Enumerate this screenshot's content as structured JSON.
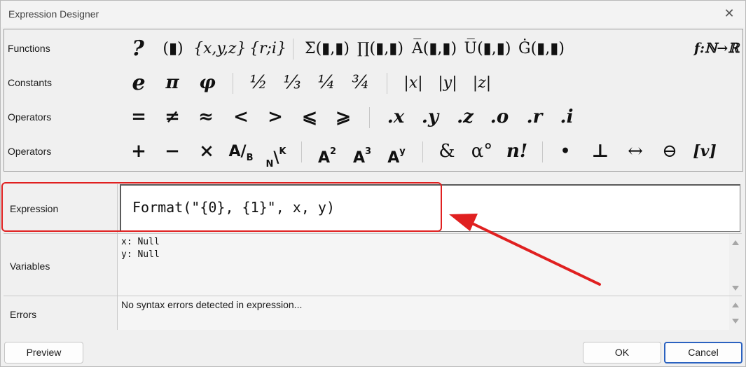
{
  "window": {
    "title": "Expression Designer",
    "close_glyph": "✕"
  },
  "palette": {
    "rows": [
      {
        "label": "Functions"
      },
      {
        "label": "Constants"
      },
      {
        "label": "Operators"
      },
      {
        "label": "Operators"
      }
    ],
    "functions": {
      "conditional": "?",
      "parens": "(▮)",
      "tuple3": "{x,y,z}",
      "tuple2": "{r;i}",
      "sum": "Σ(▮,▮)",
      "product": "∏(▮,▮)",
      "avg": "A̅(▮,▮)",
      "union": "U̅(▮,▮)",
      "g_func": "Ġ(▮,▮)",
      "function_map": "f:ℕ→ℝ"
    },
    "constants": {
      "e": "e",
      "pi": "π",
      "phi": "φ",
      "half": "½",
      "third": "⅓",
      "quarter": "¼",
      "three_quarters": "¾",
      "abs_x": "|x|",
      "abs_y": "|y|",
      "abs_z": "|z|"
    },
    "comparison": {
      "eq": "=",
      "neq": "≠",
      "approx": "≈",
      "lt": "<",
      "gt": ">",
      "leq": "⩽",
      "geq": "⩾",
      "dot_x": ".x",
      "dot_y": ".y",
      "dot_z": ".z",
      "dot_o": ".o",
      "dot_r": ".r",
      "dot_i": ".i"
    },
    "arithmetic": {
      "plus": "+",
      "minus": "−",
      "times": "×",
      "divide_num": "A",
      "divide_den": "B",
      "choose_base": "N",
      "choose_sup": "K",
      "square_base": "A",
      "square_exp": "2",
      "cube_base": "A",
      "cube_exp": "3",
      "power_base": "A",
      "power_exp": "y",
      "and": "&",
      "degree": "α°",
      "factorial": "n!",
      "dot": "•",
      "perp": "⊥",
      "harrow": "↔",
      "circle_minus": "⊖",
      "vector": "[v]"
    }
  },
  "expression": {
    "label": "Expression",
    "value": "Format(\"{0}, {1}\", x, y)"
  },
  "variables": {
    "label": "Variables",
    "lines": [
      "x: Null",
      "y: Null"
    ]
  },
  "errors": {
    "label": "Errors",
    "message": "No syntax errors detected in expression..."
  },
  "buttons": {
    "preview": "Preview",
    "ok": "OK",
    "cancel": "Cancel"
  },
  "annotation": {
    "highlight_color": "#e02020"
  }
}
